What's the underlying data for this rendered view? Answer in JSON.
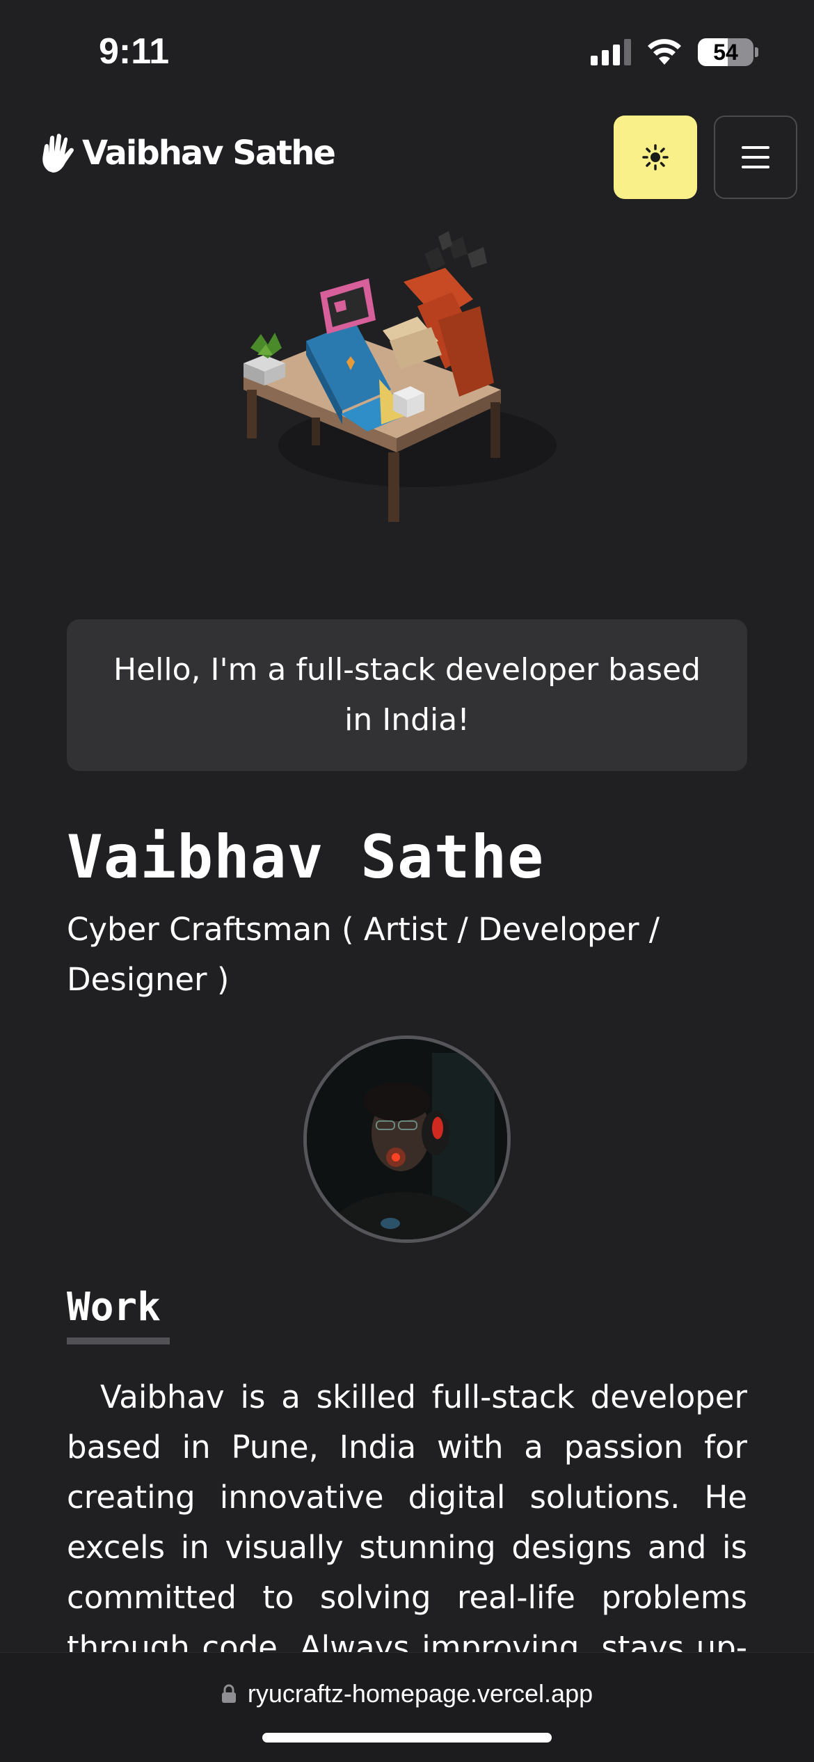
{
  "status_bar": {
    "time": "9:11",
    "battery_level": "54",
    "icons": [
      "cellular-signal-icon",
      "wifi-icon",
      "battery-icon"
    ]
  },
  "navbar": {
    "logo_text": "Vaibhav Sathe",
    "logo_icon": "hand-icon",
    "theme_toggle_icon": "sun-icon",
    "menu_icon": "hamburger-menu-icon",
    "theme_button_color": "#faf089"
  },
  "hero": {
    "greeting": "Hello, I'm a full-stack developer based in India!"
  },
  "profile": {
    "name": "Vaibhav Sathe",
    "role": "Cyber Craftsman ( Artist / Developer / Designer )"
  },
  "work": {
    "heading": "Work",
    "paragraph": "Vaibhav is a skilled full-stack developer based in Pune, India with a passion for creating innovative digital solutions. He excels in visually stunning designs and is committed to solving real-life problems through code. Always improving, stays up-to-date with the"
  },
  "browser": {
    "url": "ryucraftz-homepage.vercel.app",
    "lock_icon": "lock-icon"
  },
  "colors": {
    "background": "#202023",
    "card": "#323235",
    "accent_yellow": "#faf089"
  }
}
